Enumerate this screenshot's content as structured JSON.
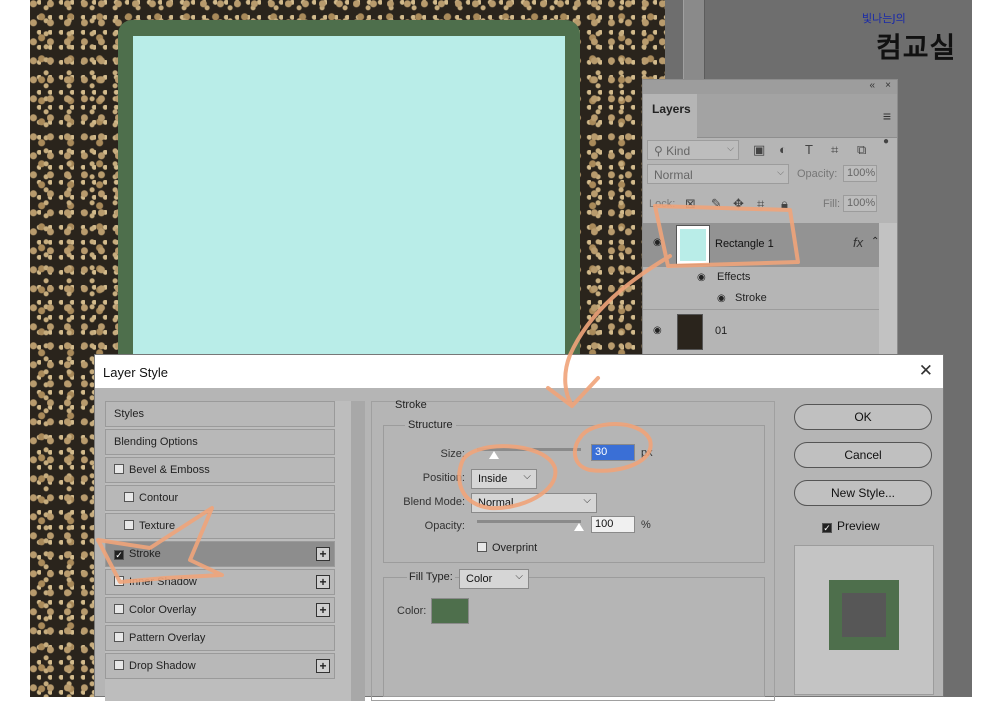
{
  "watermark": {
    "small": "빛나는J의",
    "big": "컴교실"
  },
  "layers_panel": {
    "tab": "Layers",
    "collapse_glyph": "«",
    "close_glyph": "×",
    "menu_glyph": "≡",
    "kind_label": "Kind",
    "blend_mode": "Normal",
    "opacity_label": "Opacity:",
    "opacity_value": "100%",
    "lock_label": "Lock:",
    "fill_label": "Fill:",
    "fill_value": "100%",
    "layers": [
      {
        "name": "Rectangle 1",
        "fx": "fx"
      },
      {
        "name": "01"
      }
    ],
    "effects_label": "Effects",
    "stroke_effect_label": "Stroke"
  },
  "dialog": {
    "title": "Layer Style",
    "styles_list": [
      {
        "label": "Styles",
        "checkbox": false,
        "checked": false,
        "plus": false
      },
      {
        "label": "Blending Options",
        "checkbox": false,
        "checked": false,
        "plus": false
      },
      {
        "label": "Bevel & Emboss",
        "checkbox": true,
        "checked": false,
        "plus": false
      },
      {
        "label": "Contour",
        "checkbox": true,
        "checked": false,
        "plus": false
      },
      {
        "label": "Texture",
        "checkbox": true,
        "checked": false,
        "plus": false
      },
      {
        "label": "Stroke",
        "checkbox": true,
        "checked": true,
        "plus": true
      },
      {
        "label": "Inner Shadow",
        "checkbox": true,
        "checked": false,
        "plus": true
      },
      {
        "label": "Color Overlay",
        "checkbox": true,
        "checked": false,
        "plus": true
      },
      {
        "label": "Pattern Overlay",
        "checkbox": true,
        "checked": false,
        "plus": false
      },
      {
        "label": "Drop Shadow",
        "checkbox": true,
        "checked": false,
        "plus": true
      }
    ],
    "stroke": {
      "title": "Stroke",
      "structure_title": "Structure",
      "size_label": "Size:",
      "size_value": "30",
      "size_unit": "px",
      "position_label": "Position:",
      "position_value": "Inside",
      "blend_mode_label": "Blend Mode:",
      "blend_mode_value": "Normal",
      "opacity_label": "Opacity:",
      "opacity_value": "100",
      "opacity_unit": "%",
      "overprint_label": "Overprint",
      "fill_type_label": "Fill Type:",
      "fill_type_value": "Color",
      "color_label": "Color:",
      "stroke_color": "#4e6f4c"
    },
    "buttons": {
      "ok": "OK",
      "cancel": "Cancel",
      "new_style": "New Style..."
    },
    "preview_label": "Preview",
    "preview_checked": true
  },
  "colors": {
    "rect_fill": "#b9ede8",
    "rect_stroke": "#4e6f4c",
    "annotation": "#f0a47a"
  }
}
